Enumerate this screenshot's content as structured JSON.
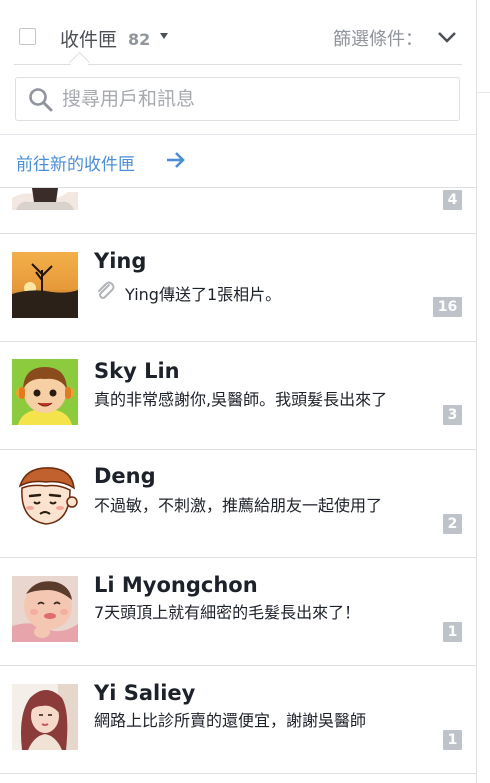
{
  "header": {
    "title": "收件匣",
    "count": "82",
    "filter_label": "篩選條件："
  },
  "search": {
    "placeholder": "搜尋用戶和訊息"
  },
  "goto_new_inbox": "前往新的收件匣",
  "partial_row": {
    "badge": "4"
  },
  "conversations": [
    {
      "name": "Ying",
      "snippet": "Ying傳送了1張相片。",
      "badge": "16"
    },
    {
      "name": "Sky Lin",
      "snippet": "真的非常感謝你,吳醫師。我頭髮長出來了",
      "badge": "3"
    },
    {
      "name": "Deng",
      "snippet": "不過敏，不刺激，推薦給朋友一起使用了",
      "badge": "2"
    },
    {
      "name": "Li Myongchon",
      "snippet": "7天頭頂上就有細密的毛髮長出來了！",
      "badge": "1"
    },
    {
      "name": "Yi Saliey",
      "snippet": "網路上比診所賣的還便宜，謝謝吳醫師",
      "badge": "1"
    }
  ],
  "icons": {
    "checkbox": "checkbox-icon",
    "caret": "caret-down-icon",
    "filter": "chevron-down-icon",
    "search": "search-icon",
    "arrow": "arrow-right-icon",
    "attachment": "paperclip-icon"
  },
  "colors": {
    "link": "#4a8fd8",
    "badge": "#bec3c9",
    "muted": "#90949c",
    "divider": "#dddfe2"
  }
}
